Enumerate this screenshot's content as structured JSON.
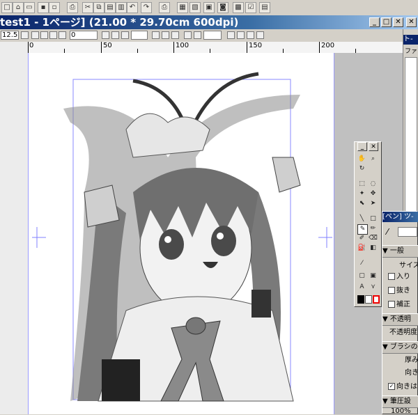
{
  "titlebar": {
    "title": "test1 - 1ページ] (21.00 * 29.70cm 600dpi)"
  },
  "toolbar2": {
    "zoom": "12.5",
    "page_field": "0"
  },
  "ruler": {
    "labels": [
      "0",
      "50",
      "100",
      "150",
      "200"
    ]
  },
  "panel_tab": {
    "label": "ト-",
    "sub": "ファ"
  },
  "pen_panel": {
    "title": "[ペン] ツ-",
    "section_general": "一般",
    "size_label": "サイズ",
    "items": [
      "入り",
      "抜き",
      "補正"
    ],
    "section_opacity": "不透明",
    "opacity_label": "不透明度",
    "section_brush": "ブラシの",
    "thickness_label": "厚み",
    "direction_label": "向き",
    "direction_check": "向きは",
    "section_pressure": "筆圧設",
    "pressure_value": "100%"
  },
  "icons": {
    "toolbar1": [
      "new-icon",
      "open-icon",
      "open-folder-icon",
      "save-icon",
      "save-as-icon",
      "cut-icon",
      "copy-icon",
      "paste-icon",
      "delete-icon",
      "undo-icon",
      "redo-icon",
      "print-icon",
      "layer-icon",
      "layer2-icon",
      "grid-icon",
      "image-icon",
      "mesh-icon",
      "check-icon",
      "window-icon"
    ]
  }
}
